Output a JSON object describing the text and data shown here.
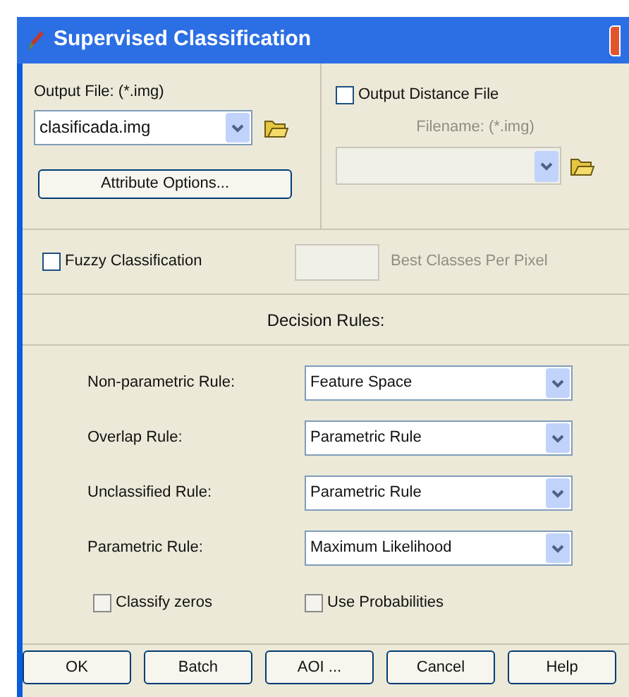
{
  "window": {
    "title": "Supervised Classification"
  },
  "output_file": {
    "label": "Output File: (*.img)",
    "value": "clasificada.img",
    "disabled": false
  },
  "attribute_button": "Attribute Options...",
  "distance": {
    "label": "Output Distance File",
    "checked": false
  },
  "distance_file": {
    "label": "Filename: (*.img)",
    "disabled": true
  },
  "fuzzy": {
    "label": "Fuzzy Classification",
    "checked": false
  },
  "best_classes": {
    "label": "Best Classes Per Pixel",
    "disabled": true
  },
  "decision_heading": "Decision Rules:",
  "rules": [
    {
      "label": "Non-parametric Rule:",
      "value": "Feature Space",
      "disabled": false
    },
    {
      "label": "Overlap Rule:",
      "value": "Parametric Rule",
      "disabled": false
    },
    {
      "label": "Unclassified Rule:",
      "value": "Parametric Rule",
      "disabled": false
    },
    {
      "label": "Parametric Rule:",
      "value": "Maximum Likelihood",
      "disabled": false
    }
  ],
  "options": [
    {
      "label": "Classify zeros",
      "checked": false
    },
    {
      "label": "Use Probabilities",
      "checked": false
    }
  ],
  "buttons": [
    "OK",
    "Batch",
    "AOI ...",
    "Cancel",
    "Help"
  ]
}
